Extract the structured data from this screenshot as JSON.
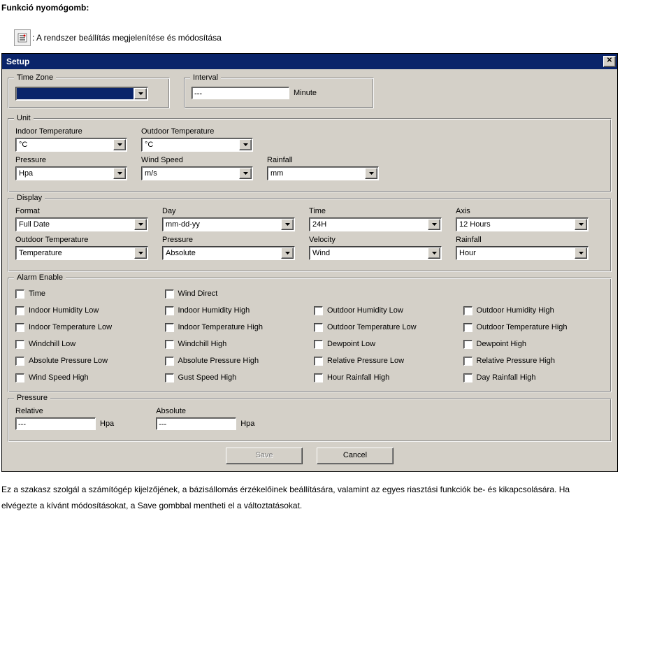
{
  "page": {
    "heading": "Funkció nyomógomb:",
    "icon_caption": ": A rendszer beállítás megjelenítése és módosítása",
    "footer1": "Ez a szakasz szolgál a számítógép kijelzőjének, a bázisállomás érzékelőinek beállítására, valamint az egyes riasztási funkciók be- és kikapcsolására. Ha",
    "footer2": "elvégezte a kívánt módosításokat, a Save gombbal mentheti el a változtatásokat."
  },
  "dialog": {
    "title": "Setup",
    "buttons": {
      "save": "Save",
      "cancel": "Cancel"
    }
  },
  "timezone": {
    "legend": "Time Zone",
    "value": ""
  },
  "interval": {
    "legend": "Interval",
    "value": "---",
    "unit": "Minute"
  },
  "unit": {
    "legend": "Unit",
    "indoor_temp": {
      "label": "Indoor Temperature",
      "value": "°C"
    },
    "outdoor_temp": {
      "label": "Outdoor Temperature",
      "value": "°C"
    },
    "pressure": {
      "label": "Pressure",
      "value": "Hpa"
    },
    "wind_speed": {
      "label": "Wind Speed",
      "value": "m/s"
    },
    "rainfall": {
      "label": "Rainfall",
      "value": "mm"
    }
  },
  "display": {
    "legend": "Display",
    "format": {
      "label": "Format",
      "value": "Full Date"
    },
    "day": {
      "label": "Day",
      "value": "mm-dd-yy"
    },
    "time": {
      "label": "Time",
      "value": "24H"
    },
    "axis": {
      "label": "Axis",
      "value": "12 Hours"
    },
    "outdoor_temp": {
      "label": "Outdoor Temperature",
      "value": "Temperature"
    },
    "pressure": {
      "label": "Pressure",
      "value": "Absolute"
    },
    "velocity": {
      "label": "Velocity",
      "value": "Wind"
    },
    "rainfall": {
      "label": "Rainfall",
      "value": "Hour"
    }
  },
  "alarm": {
    "legend": "Alarm Enable",
    "items": [
      "Time",
      "Wind Direct",
      "",
      "",
      "Indoor Humidity Low",
      "Indoor Humidity High",
      "Outdoor Humidity Low",
      "Outdoor Humidity High",
      "Indoor Temperature Low",
      "Indoor Temperature High",
      "Outdoor Temperature Low",
      "Outdoor Temperature High",
      "Windchill Low",
      "Windchill High",
      "Dewpoint Low",
      "Dewpoint High",
      "Absolute Pressure Low",
      "Absolute Pressure High",
      "Relative Pressure Low",
      "Relative Pressure High",
      "Wind Speed High",
      "Gust Speed High",
      "Hour Rainfall High",
      "Day Rainfall High"
    ]
  },
  "pressure": {
    "legend": "Pressure",
    "relative": {
      "label": "Relative",
      "value": "---",
      "unit": "Hpa"
    },
    "absolute": {
      "label": "Absolute",
      "value": "---",
      "unit": "Hpa"
    }
  },
  "icons": {
    "chevron_down": "▾"
  }
}
